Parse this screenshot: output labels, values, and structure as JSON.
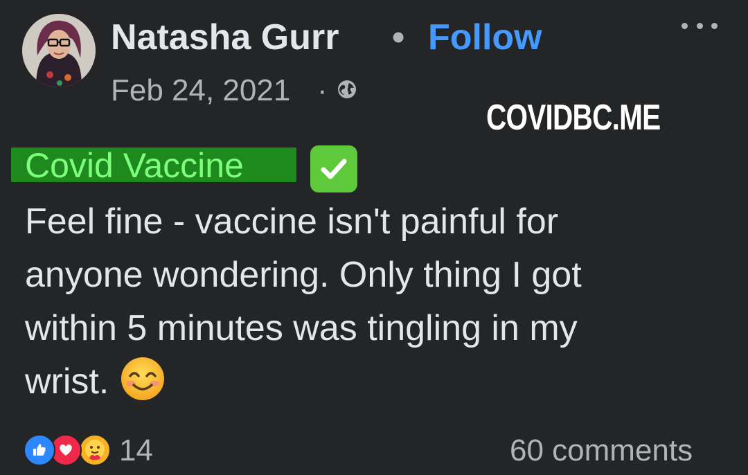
{
  "header": {
    "author_name": "Natasha Gurr",
    "separator": "•",
    "follow_label": "Follow",
    "date": "Feb 24, 2021",
    "date_separator": "·",
    "privacy_icon": "globe-icon",
    "more_icon": "more-options-icon"
  },
  "watermark": "COVIDBC.ME",
  "post": {
    "headline": "Covid Vaccine",
    "headline_icon": "check-mark-button-icon",
    "body_lines": [
      "Feel fine - vaccine isn't painful for",
      "anyone wondering. Only thing I got",
      "within 5 minutes was tingling in my",
      "wrist."
    ],
    "trailing_emoji": "smiling-face-icon"
  },
  "footer": {
    "reactions": [
      "like-icon",
      "love-icon",
      "care-icon"
    ],
    "reaction_count": "14",
    "comments_label": "60 comments"
  },
  "colors": {
    "background": "#242526",
    "text": "#e4e6eb",
    "secondary_text": "#b0b3b8",
    "link": "#4599ff",
    "highlight": "#1e8a1e",
    "highlight_text": "#7dff7d"
  }
}
